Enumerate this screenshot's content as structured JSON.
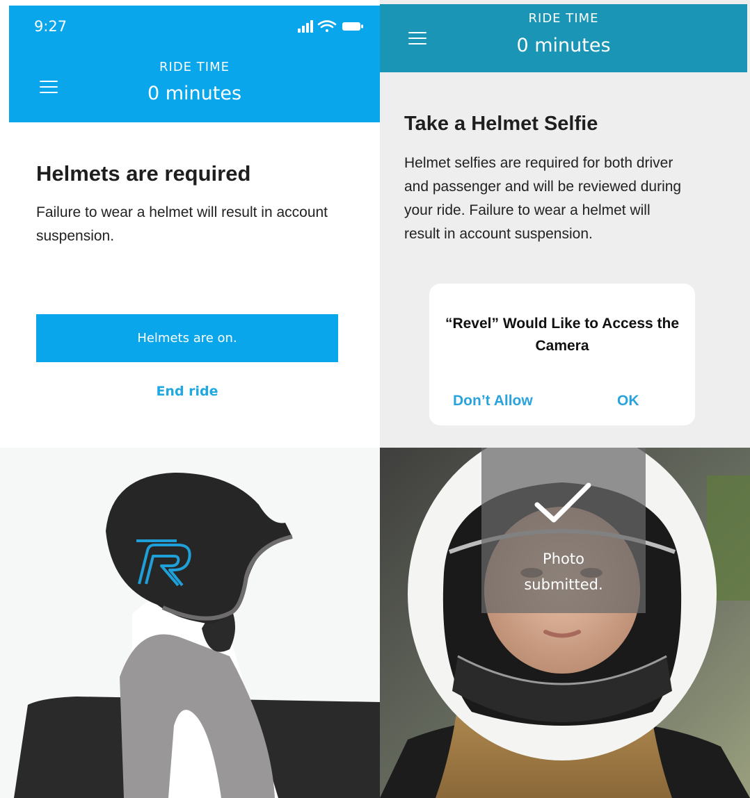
{
  "status_bar": {
    "time": "9:27"
  },
  "left_screen": {
    "header": {
      "caption": "RIDE TIME",
      "value": "0 minutes"
    },
    "title": "Helmets are required",
    "body": "Failure to wear a helmet will result in account suspension.",
    "primary_button": "Helmets are on.",
    "secondary_link": "End ride"
  },
  "right_screen": {
    "header": {
      "caption": "RIDE TIME",
      "value": "0 minutes"
    },
    "title": "Take a Helmet Selfie",
    "body": "Helmet selfies are required for both driver and passenger and will be reviewed during your ride. Failure to wear a helmet will result in account suspension.",
    "permission_dialog": {
      "title": "“Revel” Would Like to Access the Camera",
      "deny_label": "Don’t Allow",
      "allow_label": "OK"
    },
    "photo_toast": {
      "line1": "Photo",
      "line2": "submitted."
    }
  },
  "colors": {
    "brand_blue": "#0aa6ec",
    "header_teal": "#1a95b6",
    "link_blue": "#20a8e0"
  },
  "icons": [
    "menu-icon",
    "cellular-signal-icon",
    "wifi-icon",
    "battery-icon",
    "revel-logo-icon",
    "checkmark-icon"
  ]
}
